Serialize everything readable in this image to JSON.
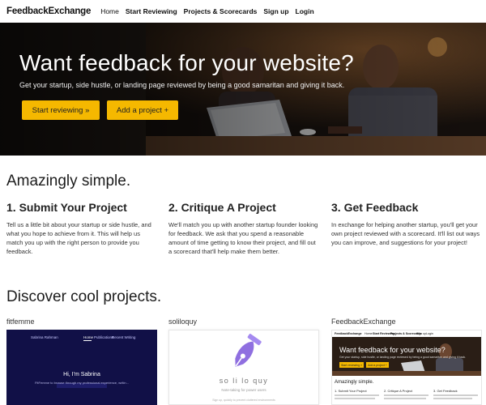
{
  "nav": {
    "brand": "FeedbackExchange",
    "links": [
      "Home",
      "Start Reviewing",
      "Projects & Scorecards",
      "Sign up",
      "Login"
    ]
  },
  "hero": {
    "title": "Want feedback for your website?",
    "subtitle": "Get your startup, side hustle, or landing page reviewed by being a good samaritan and giving it back.",
    "primary_button": "Start reviewing »",
    "secondary_button": "Add a project +"
  },
  "features": {
    "heading": "Amazingly simple.",
    "steps": [
      {
        "title": "1. Submit Your Project",
        "text": "Tell us a little bit about your startup or side hustle, and what you hope to achieve from it. This will help us match you up with the right person to provide you feedback."
      },
      {
        "title": "2. Critique A Project",
        "text": "We'll match you up with another startup founder looking for feedback. We ask that you spend a reasonable amount of time getting to know their project, and fill out a scorecard that'll help make them better."
      },
      {
        "title": "3. Get Feedback",
        "text": "In exchange for helping another startup, you'll get your own project reviewed with a scorecard. It'll list out ways you can improve, and suggestions for your project!"
      }
    ]
  },
  "projects": {
    "heading": "Discover cool projects.",
    "items": [
      {
        "name": "fitfemme",
        "preview": {
          "site_name": "Sabrina Rahman",
          "nav": [
            "Home",
            "Publications",
            "Recent Writing"
          ],
          "greeting": "Hi, I'm Sabrina",
          "description": "FitFemme to browse through my professional experience, writin..."
        }
      },
      {
        "name": "soliloquy",
        "preview": {
          "logo_text": "so li lo quy",
          "tagline": "Note-taking for power users",
          "footer": "Sign up, quickly to prevent cluttered environments"
        }
      },
      {
        "name": "FeedbackExchange",
        "preview": {
          "brand": "FeedbackExchange",
          "nav": [
            "Home",
            "Start Reviewing",
            "Projects & Scorecards",
            "Sign up",
            "Login"
          ],
          "title": "Want feedback for your website?",
          "subtitle": "Get your startup, side hustle, or landing page reviewed by being a good samaritan and giving it back.",
          "buttons": [
            "Start reviewing »",
            "Add a project +"
          ],
          "heading": "Amazingly simple.",
          "steps": [
            "1. Submit Your Project",
            "2. Critique A Project",
            "3. Get Feedback"
          ]
        }
      }
    ]
  },
  "colors": {
    "accent": "#f5b800",
    "card1_bg": "#111047",
    "logo_purple": "#8f6fe0"
  }
}
